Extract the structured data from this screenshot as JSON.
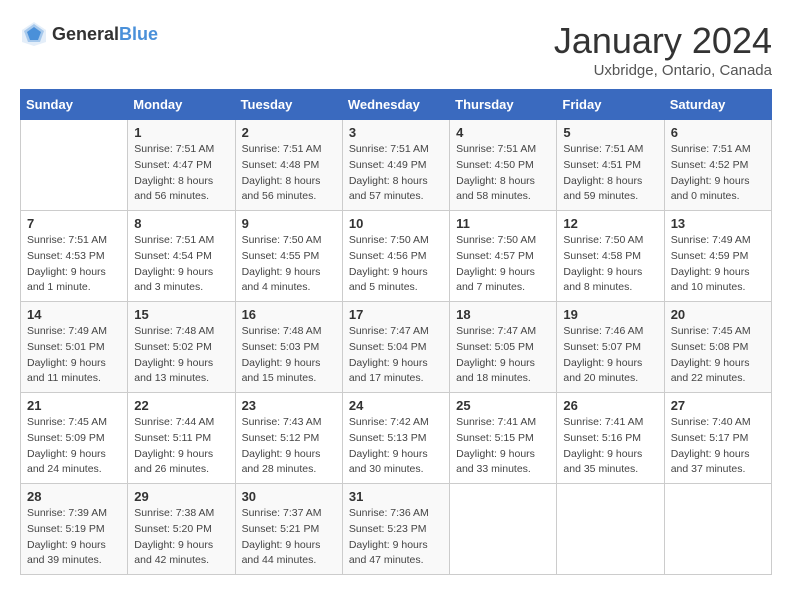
{
  "header": {
    "logo_general": "General",
    "logo_blue": "Blue",
    "month_title": "January 2024",
    "subtitle": "Uxbridge, Ontario, Canada"
  },
  "days_of_week": [
    "Sunday",
    "Monday",
    "Tuesday",
    "Wednesday",
    "Thursday",
    "Friday",
    "Saturday"
  ],
  "weeks": [
    [
      {
        "day": "",
        "info": ""
      },
      {
        "day": "1",
        "info": "Sunrise: 7:51 AM\nSunset: 4:47 PM\nDaylight: 8 hours\nand 56 minutes."
      },
      {
        "day": "2",
        "info": "Sunrise: 7:51 AM\nSunset: 4:48 PM\nDaylight: 8 hours\nand 56 minutes."
      },
      {
        "day": "3",
        "info": "Sunrise: 7:51 AM\nSunset: 4:49 PM\nDaylight: 8 hours\nand 57 minutes."
      },
      {
        "day": "4",
        "info": "Sunrise: 7:51 AM\nSunset: 4:50 PM\nDaylight: 8 hours\nand 58 minutes."
      },
      {
        "day": "5",
        "info": "Sunrise: 7:51 AM\nSunset: 4:51 PM\nDaylight: 8 hours\nand 59 minutes."
      },
      {
        "day": "6",
        "info": "Sunrise: 7:51 AM\nSunset: 4:52 PM\nDaylight: 9 hours\nand 0 minutes."
      }
    ],
    [
      {
        "day": "7",
        "info": "Sunrise: 7:51 AM\nSunset: 4:53 PM\nDaylight: 9 hours\nand 1 minute."
      },
      {
        "day": "8",
        "info": "Sunrise: 7:51 AM\nSunset: 4:54 PM\nDaylight: 9 hours\nand 3 minutes."
      },
      {
        "day": "9",
        "info": "Sunrise: 7:50 AM\nSunset: 4:55 PM\nDaylight: 9 hours\nand 4 minutes."
      },
      {
        "day": "10",
        "info": "Sunrise: 7:50 AM\nSunset: 4:56 PM\nDaylight: 9 hours\nand 5 minutes."
      },
      {
        "day": "11",
        "info": "Sunrise: 7:50 AM\nSunset: 4:57 PM\nDaylight: 9 hours\nand 7 minutes."
      },
      {
        "day": "12",
        "info": "Sunrise: 7:50 AM\nSunset: 4:58 PM\nDaylight: 9 hours\nand 8 minutes."
      },
      {
        "day": "13",
        "info": "Sunrise: 7:49 AM\nSunset: 4:59 PM\nDaylight: 9 hours\nand 10 minutes."
      }
    ],
    [
      {
        "day": "14",
        "info": "Sunrise: 7:49 AM\nSunset: 5:01 PM\nDaylight: 9 hours\nand 11 minutes."
      },
      {
        "day": "15",
        "info": "Sunrise: 7:48 AM\nSunset: 5:02 PM\nDaylight: 9 hours\nand 13 minutes."
      },
      {
        "day": "16",
        "info": "Sunrise: 7:48 AM\nSunset: 5:03 PM\nDaylight: 9 hours\nand 15 minutes."
      },
      {
        "day": "17",
        "info": "Sunrise: 7:47 AM\nSunset: 5:04 PM\nDaylight: 9 hours\nand 17 minutes."
      },
      {
        "day": "18",
        "info": "Sunrise: 7:47 AM\nSunset: 5:05 PM\nDaylight: 9 hours\nand 18 minutes."
      },
      {
        "day": "19",
        "info": "Sunrise: 7:46 AM\nSunset: 5:07 PM\nDaylight: 9 hours\nand 20 minutes."
      },
      {
        "day": "20",
        "info": "Sunrise: 7:45 AM\nSunset: 5:08 PM\nDaylight: 9 hours\nand 22 minutes."
      }
    ],
    [
      {
        "day": "21",
        "info": "Sunrise: 7:45 AM\nSunset: 5:09 PM\nDaylight: 9 hours\nand 24 minutes."
      },
      {
        "day": "22",
        "info": "Sunrise: 7:44 AM\nSunset: 5:11 PM\nDaylight: 9 hours\nand 26 minutes."
      },
      {
        "day": "23",
        "info": "Sunrise: 7:43 AM\nSunset: 5:12 PM\nDaylight: 9 hours\nand 28 minutes."
      },
      {
        "day": "24",
        "info": "Sunrise: 7:42 AM\nSunset: 5:13 PM\nDaylight: 9 hours\nand 30 minutes."
      },
      {
        "day": "25",
        "info": "Sunrise: 7:41 AM\nSunset: 5:15 PM\nDaylight: 9 hours\nand 33 minutes."
      },
      {
        "day": "26",
        "info": "Sunrise: 7:41 AM\nSunset: 5:16 PM\nDaylight: 9 hours\nand 35 minutes."
      },
      {
        "day": "27",
        "info": "Sunrise: 7:40 AM\nSunset: 5:17 PM\nDaylight: 9 hours\nand 37 minutes."
      }
    ],
    [
      {
        "day": "28",
        "info": "Sunrise: 7:39 AM\nSunset: 5:19 PM\nDaylight: 9 hours\nand 39 minutes."
      },
      {
        "day": "29",
        "info": "Sunrise: 7:38 AM\nSunset: 5:20 PM\nDaylight: 9 hours\nand 42 minutes."
      },
      {
        "day": "30",
        "info": "Sunrise: 7:37 AM\nSunset: 5:21 PM\nDaylight: 9 hours\nand 44 minutes."
      },
      {
        "day": "31",
        "info": "Sunrise: 7:36 AM\nSunset: 5:23 PM\nDaylight: 9 hours\nand 47 minutes."
      },
      {
        "day": "",
        "info": ""
      },
      {
        "day": "",
        "info": ""
      },
      {
        "day": "",
        "info": ""
      }
    ]
  ]
}
